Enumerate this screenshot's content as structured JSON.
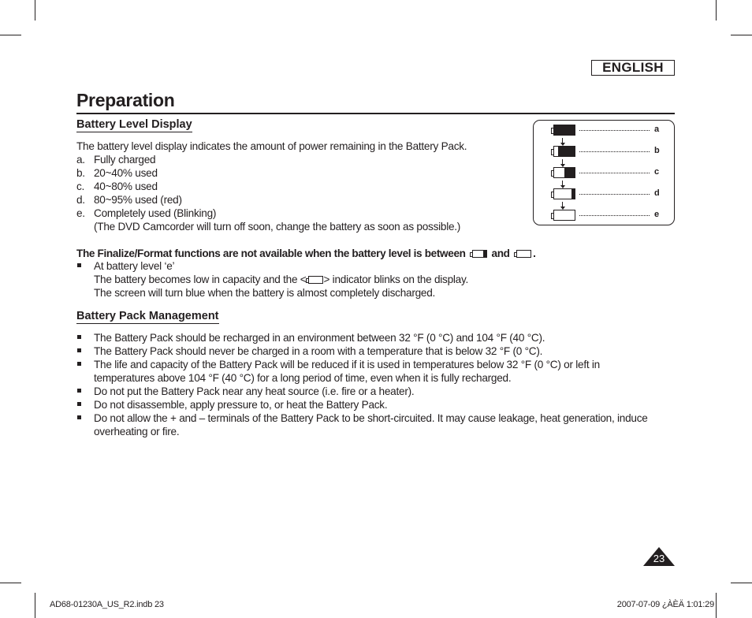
{
  "language_tab": "ENGLISH",
  "page_title": "Preparation",
  "battery_level_display": {
    "heading": "Battery Level Display",
    "intro": "The battery level display indicates the amount of power remaining in the Battery Pack.",
    "levels": [
      {
        "marker": "a.",
        "text": "Fully charged"
      },
      {
        "marker": "b.",
        "text": "20~40% used"
      },
      {
        "marker": "c.",
        "text": "40~80% used"
      },
      {
        "marker": "d.",
        "text": "80~95% used (red)"
      },
      {
        "marker": "e.",
        "text": "Completely used (Blinking)"
      }
    ],
    "level_e_note": "(The DVD Camcorder will turn off soon, change the battery as soon as possible.)",
    "diagram": {
      "labels": [
        "a",
        "b",
        "c",
        "d",
        "e"
      ],
      "fill_fractions": [
        1.0,
        0.8,
        0.5,
        0.15,
        0.0
      ]
    }
  },
  "finalize_note": {
    "text_before": "The Finalize/Format functions are not available when the battery level is between",
    "text_and": "and",
    "text_end": "."
  },
  "level_e_bullet": {
    "title": "At battery level ‘e’",
    "line1_before": "The battery becomes low in capacity and the <",
    "line1_after": "> indicator blinks on the display.",
    "line2": "The screen will turn blue when the battery is almost completely discharged."
  },
  "battery_pack_management": {
    "heading": "Battery Pack Management",
    "bullets": [
      [
        "The Battery Pack should be recharged in an environment between 32 °F (0 °C) and 104 °F (40 °C)."
      ],
      [
        "The Battery Pack should never be charged in a room with a temperature that is below 32 °F (0 °C)."
      ],
      [
        "The life and capacity of the Battery Pack will be reduced if it is used in temperatures below 32 °F (0 °C) or left in",
        "temperatures above 104 °F (40 °C) for a long period of time, even when it is fully recharged."
      ],
      [
        "Do not put the Battery Pack near any heat source (i.e. fire or a heater)."
      ],
      [
        "Do not disassemble, apply pressure to, or heat the Battery Pack."
      ],
      [
        "Do not allow the + and – terminals of the Battery Pack to be short-circuited. It may cause leakage, heat generation, induce",
        "overheating or fire."
      ]
    ]
  },
  "page_number": "23",
  "footer": {
    "left": "AD68-01230A_US_R2.indb   23",
    "right": "2007-07-09   ¿ÀÈÄ 1:01:29"
  }
}
